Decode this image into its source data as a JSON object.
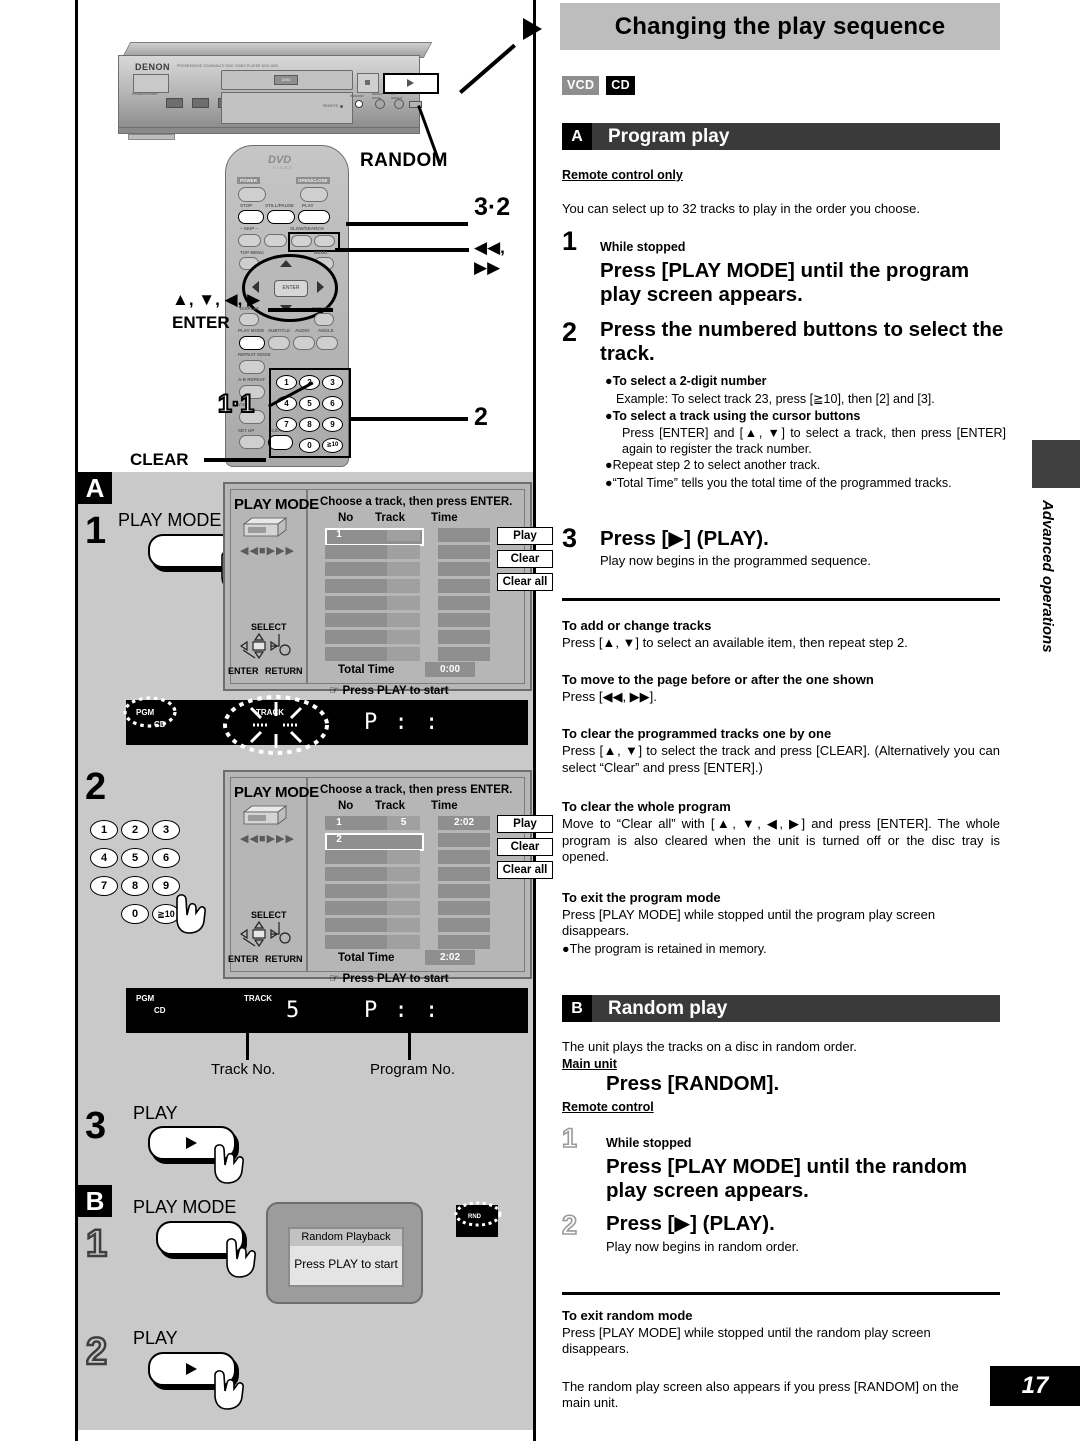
{
  "header": {
    "title": "Changing the play sequence",
    "disc_tags": [
      "VCD",
      "CD"
    ],
    "page_number": "17",
    "side_tab_text": "Advanced operations"
  },
  "illustration": {
    "brand": "DENON",
    "brand_sub": "PROGRESSIVE SCAN/MULTI DISC VIDEO PLAYER DVD-1600",
    "power_label": "POWER/STANDBY",
    "open_close": "OPEN/CLOSE",
    "dvd_logo": "DVD",
    "dvd_sub": "VIDEO",
    "callout_random": "RANDOM",
    "callout_play_step": "3·2",
    "callout_search": "◀◀, ▶▶",
    "callout_cursor": "▲, ▼, ◀, ▶",
    "callout_enter": "ENTER",
    "callout_playmode": "1·1",
    "callout_numpad": "2",
    "callout_clear": "CLEAR",
    "remote_labels": {
      "power": "POWER",
      "open_close": "OPEN/CLOSE",
      "stop": "STOP",
      "still_pause": "STILL/PAUSE",
      "play": "PLAY",
      "skip": "– SKIP –",
      "slow_search": "SLOW/SEARCH",
      "top_menu": "TOP MENU",
      "menu": "MENU",
      "display": "DISPLAY",
      "return": "RETURN",
      "enter": "ENTER",
      "play_mode": "PLAY MODE",
      "subtitle": "SUBTITLE",
      "audio": "AUDIO",
      "angle": "ANGLE",
      "repeat_mode": "REPEAT MODE",
      "ab_repeat": "A-B REPEAT",
      "vss": "V.S.S.",
      "set_up": "SET UP",
      "clear": "CLEAR"
    },
    "numpad_keys": [
      "1",
      "2",
      "3",
      "4",
      "5",
      "6",
      "7",
      "8",
      "9",
      "0",
      "≧10"
    ]
  },
  "left_steps": {
    "section_a_badge": "A",
    "section_b_badge": "B",
    "step1": {
      "num": "1",
      "button_label": "PLAY MODE"
    },
    "step2": {
      "num": "2",
      "numpad_keys": [
        "1",
        "2",
        "3",
        "4",
        "5",
        "6",
        "7",
        "8",
        "9",
        "0",
        "≧10"
      ]
    },
    "step3": {
      "num": "3",
      "button_label": "PLAY"
    },
    "b_step1": {
      "num": "1",
      "button_label": "PLAY MODE"
    },
    "b_step2": {
      "num": "2",
      "button_label": "PLAY"
    },
    "captions": {
      "track_no": "Track No.",
      "program_no": "Program No."
    }
  },
  "osd_screen": {
    "title": "PLAY MODE",
    "prompt": "Choose a track, then press ENTER.",
    "columns": [
      "No",
      "Track",
      "Time"
    ],
    "buttons": [
      "Play",
      "Clear",
      "Clear all"
    ],
    "total_time_label": "Total Time",
    "footer": "Press PLAY to start",
    "select_label": "SELECT",
    "enter_label": "ENTER",
    "return_label": "RETURN",
    "state_1": {
      "rows": [
        {
          "no": "1",
          "track": "",
          "time": "",
          "selected": true
        },
        {
          "no": "",
          "track": "",
          "time": "",
          "selected": false
        },
        {
          "no": "",
          "track": "",
          "time": "",
          "selected": false
        },
        {
          "no": "",
          "track": "",
          "time": "",
          "selected": false
        },
        {
          "no": "",
          "track": "",
          "time": "",
          "selected": false
        },
        {
          "no": "",
          "track": "",
          "time": "",
          "selected": false
        },
        {
          "no": "",
          "track": "",
          "time": "",
          "selected": false
        },
        {
          "no": "",
          "track": "",
          "time": "",
          "selected": false
        }
      ],
      "total_time": "0:00"
    },
    "state_2": {
      "rows": [
        {
          "no": "1",
          "track": "5",
          "time": "2:02",
          "selected": false
        },
        {
          "no": "2",
          "track": "",
          "time": "",
          "selected": true
        },
        {
          "no": "",
          "track": "",
          "time": "",
          "selected": false
        },
        {
          "no": "",
          "track": "",
          "time": "",
          "selected": false
        },
        {
          "no": "",
          "track": "",
          "time": "",
          "selected": false
        },
        {
          "no": "",
          "track": "",
          "time": "",
          "selected": false
        },
        {
          "no": "",
          "track": "",
          "time": "",
          "selected": false
        },
        {
          "no": "",
          "track": "",
          "time": "",
          "selected": false
        }
      ],
      "total_time": "2:02"
    }
  },
  "fl_display": {
    "pgm": "PGM",
    "cd": "CD",
    "track": "TRACK",
    "state1_segments": "P :  :",
    "state2_track": "5",
    "state2_segments": "P :  :"
  },
  "random_osd": {
    "window_title": "Random Playback",
    "window_body": "Press PLAY to start",
    "indicator": "RND"
  },
  "section_a": {
    "letter": "A",
    "name": "Program play",
    "remote_note": "Remote control only",
    "intro": "You can select up to 32 tracks to play in the order you choose.",
    "step1": {
      "num": "1",
      "condition": "While stopped",
      "instruction": "Press [PLAY MODE] until the program play screen appears."
    },
    "step2": {
      "num": "2",
      "instruction": "Press the numbered buttons to select the track.",
      "bullets": [
        {
          "head": "To select a 2-digit number",
          "text": "Example:  To select track 23, press [≧10], then [2] and [3]."
        },
        {
          "head": "To select a track using the cursor buttons",
          "text": "Press [ENTER] and [▲, ▼] to select a track, then press [ENTER] again to register the track number."
        },
        {
          "head": "",
          "text": "Repeat step 2 to select another track."
        },
        {
          "head": "",
          "text": "“Total Time” tells you the total time of the programmed tracks."
        }
      ]
    },
    "step3": {
      "num": "3",
      "instruction": "Press [▶] (PLAY).",
      "sub": "Play now begins in the programmed sequence."
    },
    "notes": [
      {
        "head": "To add or change tracks",
        "body": "Press [▲, ▼] to select an available item, then repeat step 2."
      },
      {
        "head": "To move to the page before or after the one shown",
        "body": "Press [◀◀, ▶▶]."
      },
      {
        "head": "To clear the programmed tracks one by one",
        "body": "Press [▲, ▼] to select the track and press [CLEAR]. (Alternatively you can select “Clear” and press [ENTER].)"
      },
      {
        "head": "To clear the whole program",
        "body": "Move to “Clear all” with [▲, ▼, ◀, ▶] and press [ENTER]. The whole program is also cleared when the unit is turned off or the disc tray is opened."
      },
      {
        "head": "To exit the program mode",
        "body": "Press [PLAY MODE] while stopped until the program play screen disappears."
      }
    ],
    "exit_bullet": "The program is retained in memory."
  },
  "section_b": {
    "letter": "B",
    "name": "Random play",
    "intro": "The unit plays the tracks on a disc in random order.",
    "main_unit_label": "Main unit",
    "main_unit_instruction": "Press [RANDOM].",
    "remote_label": "Remote control",
    "step1": {
      "num": "1",
      "condition": "While stopped",
      "instruction": "Press [PLAY MODE] until the random play screen appears."
    },
    "step2": {
      "num": "2",
      "instruction": "Press [▶] (PLAY).",
      "sub": "Play now begins in random order."
    },
    "notes": [
      {
        "head": "To exit random mode",
        "body": "Press [PLAY MODE] while stopped until the random play screen disappears."
      }
    ],
    "footer": "The random play screen also appears if you press [RANDOM] on the main unit."
  }
}
